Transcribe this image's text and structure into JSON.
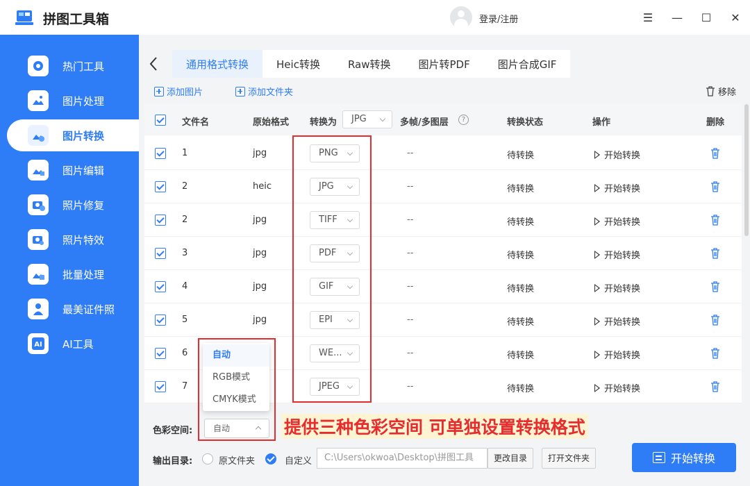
{
  "app": {
    "title": "拼图工具箱",
    "login_label": "登录/注册"
  },
  "window_controls": {
    "menu": "☰",
    "minimize": "—",
    "maximize": "☐",
    "close": "✕"
  },
  "sidebar": {
    "items": [
      {
        "label": "热门工具",
        "icon": "hot-tools-icon"
      },
      {
        "label": "图片处理",
        "icon": "image-process-icon"
      },
      {
        "label": "图片转换",
        "icon": "image-convert-icon",
        "active": true
      },
      {
        "label": "图片编辑",
        "icon": "image-edit-icon"
      },
      {
        "label": "照片修复",
        "icon": "photo-repair-icon"
      },
      {
        "label": "照片特效",
        "icon": "photo-effects-icon"
      },
      {
        "label": "批量处理",
        "icon": "batch-process-icon"
      },
      {
        "label": "最美证件照",
        "icon": "id-photo-icon"
      },
      {
        "label": "AI工具",
        "icon": "ai-tools-icon"
      }
    ]
  },
  "tabs": [
    {
      "label": "通用格式转换",
      "active": true
    },
    {
      "label": "Heic转换"
    },
    {
      "label": "Raw转换"
    },
    {
      "label": "图片转PDF"
    },
    {
      "label": "图片合成GIF"
    }
  ],
  "toolbar": {
    "add_image": "添加图片",
    "add_folder": "添加文件夹",
    "remove": "移除"
  },
  "table": {
    "headers": {
      "filename": "文件名",
      "original_format": "原始格式",
      "convert_to": "转换为",
      "convert_to_value": "JPG",
      "multiframe": "多帧/多图层",
      "help": "?",
      "status": "转换状态",
      "action": "操作",
      "delete": "删除"
    },
    "rows": [
      {
        "name": "1",
        "original": "jpg",
        "target": "PNG",
        "multiframe": "--",
        "status": "待转换",
        "action": "开始转换"
      },
      {
        "name": "2",
        "original": "heic",
        "target": "JPG",
        "multiframe": "--",
        "status": "待转换",
        "action": "开始转换"
      },
      {
        "name": "2",
        "original": "jpg",
        "target": "TIFF",
        "multiframe": "--",
        "status": "待转换",
        "action": "开始转换"
      },
      {
        "name": "3",
        "original": "jpg",
        "target": "PDF",
        "multiframe": "--",
        "status": "待转换",
        "action": "开始转换"
      },
      {
        "name": "4",
        "original": "jpg",
        "target": "GIF",
        "multiframe": "--",
        "status": "待转换",
        "action": "开始转换"
      },
      {
        "name": "5",
        "original": "jpg",
        "target": "EPI",
        "multiframe": "--",
        "status": "待转换",
        "action": "开始转换"
      },
      {
        "name": "6",
        "original": "",
        "target": "WE...",
        "multiframe": "--",
        "status": "待转换",
        "action": "开始转换"
      },
      {
        "name": "7",
        "original": "",
        "target": "JPEG",
        "multiframe": "--",
        "status": "待转换",
        "action": "开始转换"
      }
    ]
  },
  "color_space": {
    "label": "色彩空间:",
    "value": "自动",
    "options": [
      "自动",
      "RGB模式",
      "CMYK模式"
    ]
  },
  "annotation": "提供三种色彩空间 可单独设置转换格式",
  "output": {
    "label": "输出目录:",
    "option_original": "原文件夹",
    "option_custom": "自定义",
    "path": "C:\\Users\\okwoa\\Desktop\\拼图工具",
    "change_dir": "更改目录",
    "open_folder": "打开文件夹"
  },
  "start_button": "开始转换",
  "colors": {
    "accent": "#2f7df6",
    "highlight": "#e62c2c",
    "annotation_bg": "#fcf4d2"
  }
}
